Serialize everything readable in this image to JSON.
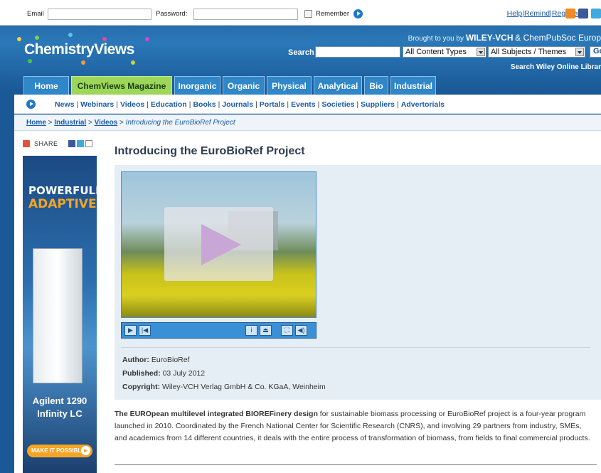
{
  "login": {
    "email_label": "Email",
    "password_label": "Password:",
    "remember_label": "Remember",
    "links": [
      "Help",
      "Remind",
      "Register"
    ]
  },
  "header": {
    "logo": "ChemistryViews",
    "brought_by": "Brought to you by",
    "wiley": "WILEY-VCH",
    "chempubsoc": "& ChemPubSoc Europ",
    "search_label": "Search",
    "content_select": "All Content Types",
    "subject_select": "All Subjects / Themes",
    "go_label": "Go",
    "search_wiley": "Search Wiley Online Librar"
  },
  "tabs": [
    "Home",
    "ChemViews Magazine",
    "Inorganic",
    "Organic",
    "Physical",
    "Analytical",
    "Bio",
    "Industrial"
  ],
  "nav": [
    "News",
    "Webinars",
    "Videos",
    "Education",
    "Books",
    "Journals",
    "Portals",
    "Events",
    "Societies",
    "Suppliers",
    "Advertorials"
  ],
  "breadcrumb": {
    "home": "Home",
    "industrial": "Industrial",
    "videos": "Videos",
    "current": "Introducing the EuroBioRef Project"
  },
  "share_label": "SHARE",
  "ad": {
    "line1": "POWERFULLY",
    "line2": "ADAPTIVE",
    "product1": "Agilent 1290",
    "product2": "Infinity LC",
    "cta": "MAKE IT POSSIBLE"
  },
  "article": {
    "title": "Introducing the EuroBioRef Project",
    "author_label": "Author:",
    "author": "EuroBioRef",
    "published_label": "Published:",
    "published": "03 July 2012",
    "copyright_label": "Copyright:",
    "copyright": "Wiley-VCH Verlag GmbH & Co. KGaA, Weinheim",
    "body_bold": "The EUROpean multilevel integrated BIOREFinery design",
    "body_rest": " for sustainable biomass processing or EuroBioRef project is a four-year program launched in 2010. Coordinated by the French National Center for Scientific Research (CNRS), and involving 29 partners from industry, SMEs, and academics from 14 different countries, it deals with the entire process of transformation of biomass, from fields to final commercial products."
  },
  "colors": {
    "header_blue": "#1f5d99",
    "tab_blue": "#2f86c8",
    "magazine_green": "#9ed65a",
    "link_blue": "#1a5aa8",
    "ad_orange": "#f5a526"
  }
}
